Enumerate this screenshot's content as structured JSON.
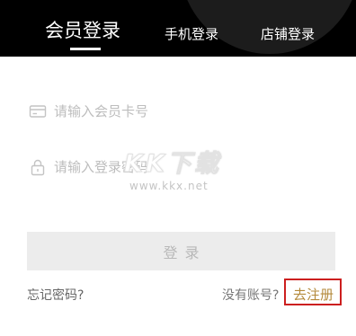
{
  "tabs": {
    "member_login": "会员登录",
    "phone_login": "手机登录",
    "store_login": "店铺登录"
  },
  "form": {
    "card_placeholder": "请输入会员卡号",
    "password_placeholder": "请输入登录密码",
    "card_icon": "card-icon",
    "lock_icon": "lock-icon"
  },
  "watermark": {
    "brand": "KK下载",
    "url": "www.kkx.net"
  },
  "actions": {
    "login": "登录",
    "forgot_password": "忘记密码?",
    "no_account": "没有账号?",
    "register": "去注册"
  },
  "colors": {
    "header_bg": "#000000",
    "register_text": "#b48a3c",
    "highlight_box": "#cc1f1f",
    "login_button_bg": "#ececec"
  }
}
